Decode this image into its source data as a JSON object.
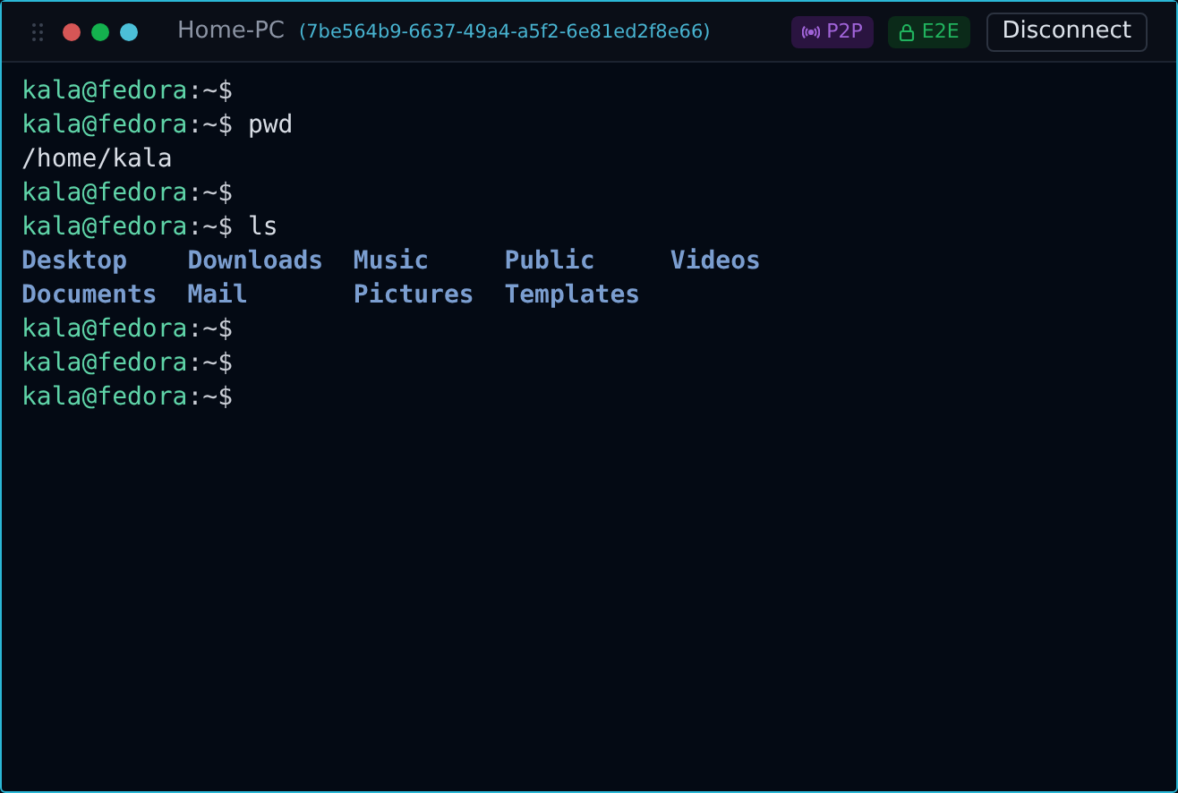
{
  "window": {
    "title": "Home-PC",
    "session_id": "(7be564b9-6637-49a4-a5f2-6e81ed2f8e66)"
  },
  "badges": [
    {
      "kind": "p2p",
      "label": "P2P"
    },
    {
      "kind": "e2e",
      "label": "E2E"
    }
  ],
  "disconnect_button": "Disconnect",
  "terminal": [
    {
      "kind": "prompt",
      "user_host": "kala@fedora",
      "path": ":~$"
    },
    {
      "kind": "prompt",
      "user_host": "kala@fedora",
      "path": ":~$",
      "command": "pwd"
    },
    {
      "kind": "output",
      "text": "/home/kala"
    },
    {
      "kind": "prompt",
      "user_host": "kala@fedora",
      "path": ":~$"
    },
    {
      "kind": "prompt",
      "user_host": "kala@fedora",
      "path": ":~$",
      "command": "ls"
    },
    {
      "kind": "listing",
      "entries": [
        "Desktop",
        "Downloads",
        "Music",
        "Public",
        "Videos"
      ]
    },
    {
      "kind": "listing",
      "entries": [
        "Documents",
        "Mail",
        "Pictures",
        "Templates"
      ]
    },
    {
      "kind": "prompt",
      "user_host": "kala@fedora",
      "path": ":~$"
    },
    {
      "kind": "prompt",
      "user_host": "kala@fedora",
      "path": ":~$"
    },
    {
      "kind": "prompt",
      "user_host": "kala@fedora",
      "path": ":~$"
    }
  ]
}
